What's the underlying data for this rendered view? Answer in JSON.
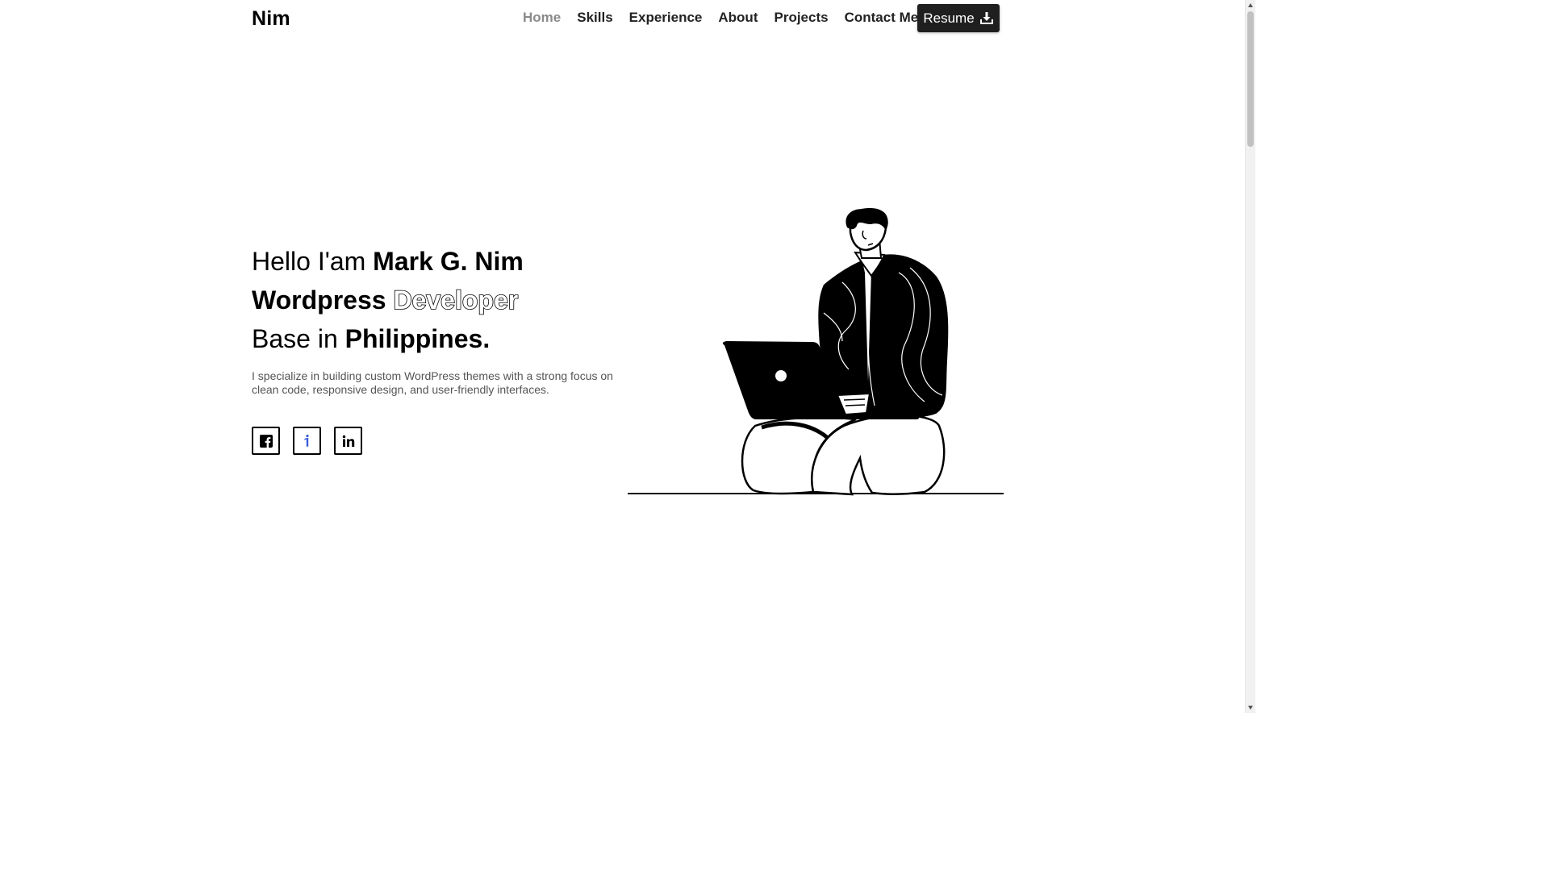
{
  "header": {
    "logo": "Nim",
    "nav": [
      {
        "label": "Home",
        "active": true
      },
      {
        "label": "Skills",
        "active": false
      },
      {
        "label": "Experience",
        "active": false
      },
      {
        "label": "About",
        "active": false
      },
      {
        "label": "Projects",
        "active": false
      },
      {
        "label": "Contact Me",
        "active": false
      }
    ],
    "resume_label": "Resume",
    "resume_icon": "download-icon"
  },
  "hero": {
    "line1_plain": "Hello I'am ",
    "line1_bold": "Mark G. Nim",
    "line2_bold": "Wordpress ",
    "line2_outline": "Developer",
    "line3_plain": "Base in ",
    "line3_bold": "Philippines.",
    "description": "I specialize in building custom WordPress themes with a strong focus on clean code, responsive design, and user-friendly interfaces."
  },
  "socials": [
    {
      "icon": "facebook-icon"
    },
    {
      "icon": "info-icon",
      "color": "#3b5bdb"
    },
    {
      "icon": "linkedin-icon"
    }
  ],
  "illustration": "person-with-laptop-illustration"
}
